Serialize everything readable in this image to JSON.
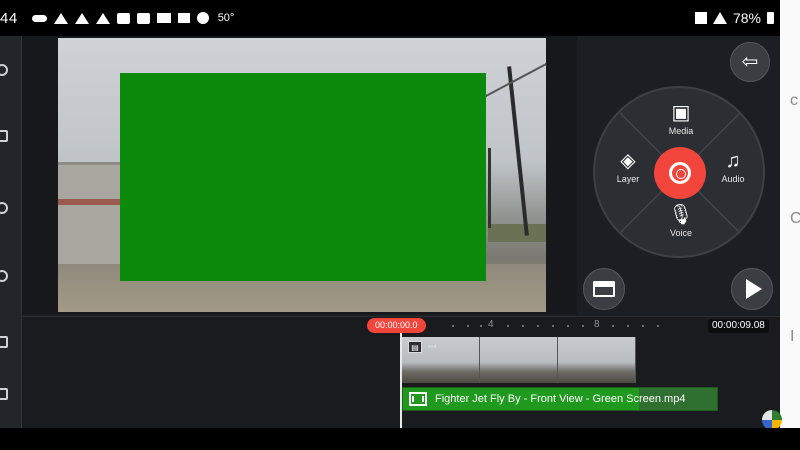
{
  "status_bar": {
    "time": "44",
    "temperature": "50°",
    "battery": "78%",
    "icons_left": [
      "voicemail-icon",
      "wifi-icon",
      "wifi-icon",
      "wifi-icon",
      "facebook-icon",
      "mail-icon",
      "video-icon",
      "check-icon",
      "sun-icon"
    ],
    "icons_right": [
      "mute-icon",
      "signal-icon",
      "battery-icon"
    ]
  },
  "editor": {
    "menu": {
      "center": "camera-icon",
      "items": [
        {
          "label": "Media",
          "icon": "media-icon"
        },
        {
          "label": "Layer",
          "icon": "layers-icon"
        },
        {
          "label": "Audio",
          "icon": "music-icon"
        },
        {
          "label": "Voice",
          "icon": "microphone-icon"
        }
      ]
    },
    "exit_icon": "exit-icon",
    "store_icon": "store-icon",
    "play_icon": "play-icon"
  },
  "timeline": {
    "playhead_time": "00:00:00.0",
    "total_time": "00:00:09.08",
    "ruler_marks": [
      "4",
      "8"
    ],
    "video_clip_badge": "▤",
    "video_clip_dots": "•••",
    "overlay_clip_label": "Fighter Jet Fly By - Front View - Green Screen.mp4"
  },
  "side_strip_chars": [
    "c",
    "C",
    "I"
  ]
}
